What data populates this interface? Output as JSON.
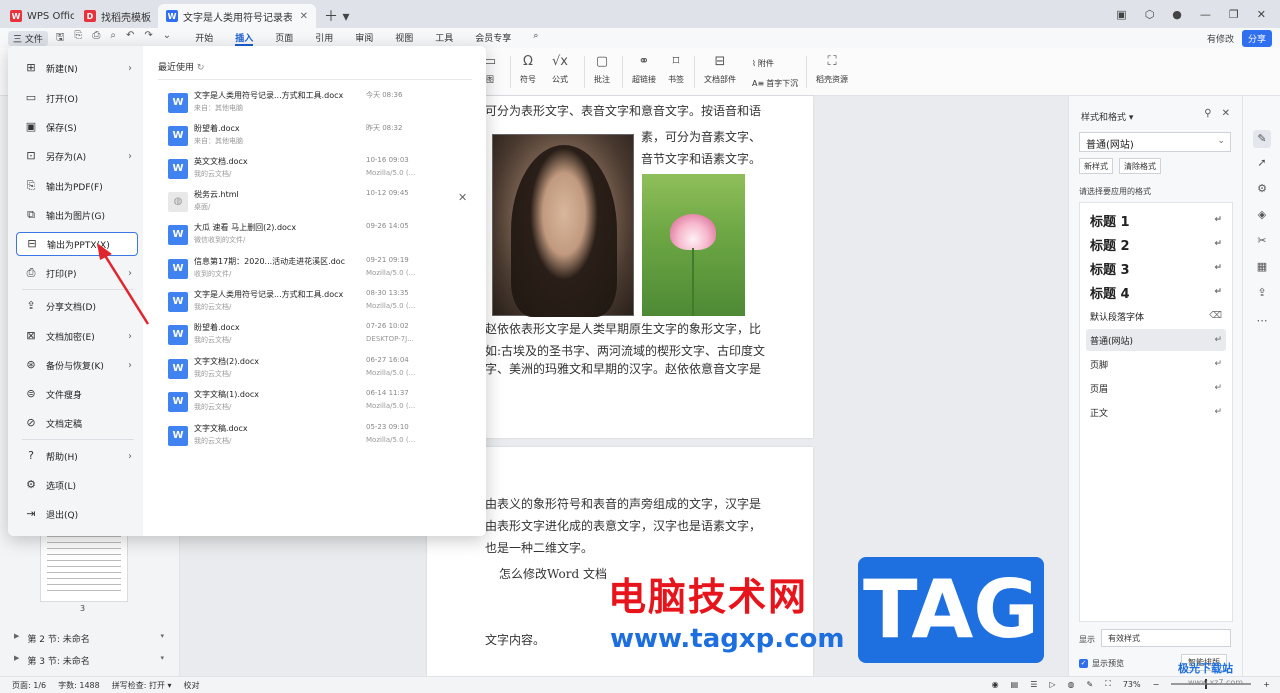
{
  "tabs": [
    {
      "label": "WPS Office",
      "icon": "wps-logo-icon",
      "color": "#e8323c"
    },
    {
      "label": "找稻壳模板",
      "icon": "docer-logo-icon",
      "color": "#e8323c"
    },
    {
      "label": "文字是人类用符号记录表达信息以",
      "icon": "word-doc-icon",
      "color": "#2f6ff0"
    }
  ],
  "menubar": {
    "file": "三 文件",
    "tabs": [
      "开始",
      "插入",
      "页面",
      "引用",
      "审阅",
      "视图",
      "工具",
      "会员专享"
    ],
    "active_tab": "插入",
    "modify": "有修改",
    "share": "分享"
  },
  "ribbon": [
    {
      "label": "图",
      "icon": "image-icon"
    },
    {
      "label": "符号",
      "icon": "omega-icon"
    },
    {
      "label": "公式",
      "icon": "formula-icon"
    },
    {
      "label": "批注",
      "icon": "comment-icon"
    },
    {
      "label": "超链接",
      "icon": "link-icon"
    },
    {
      "label": "书签",
      "icon": "bookmark-icon"
    },
    {
      "label": "文档部件",
      "icon": "doc-part-icon"
    },
    {
      "label": "附件",
      "icon": "attachment-icon"
    },
    {
      "label": "首字下沉",
      "icon": "drop-cap-icon"
    },
    {
      "label": "稻壳资源",
      "icon": "resource-icon"
    }
  ],
  "file_menu": {
    "items": [
      {
        "label": "新建(N)",
        "icon": "new-icon",
        "chevron": true
      },
      {
        "label": "打开(O)",
        "icon": "open-folder-icon",
        "chevron": false
      },
      {
        "label": "保存(S)",
        "icon": "save-icon",
        "chevron": false
      },
      {
        "label": "另存为(A)",
        "icon": "save-as-icon",
        "chevron": true
      },
      {
        "label": "输出为PDF(F)",
        "icon": "pdf-icon",
        "chevron": false
      },
      {
        "label": "输出为图片(G)",
        "icon": "image-export-icon",
        "chevron": false
      },
      {
        "label": "输出为PPTX(X)",
        "icon": "pptx-icon",
        "chevron": false
      },
      {
        "label": "打印(P)",
        "icon": "print-icon",
        "chevron": true
      },
      {
        "label": "分享文档(D)",
        "icon": "share-icon",
        "chevron": false
      },
      {
        "label": "文档加密(E)",
        "icon": "lock-icon",
        "chevron": true
      },
      {
        "label": "备份与恢复(K)",
        "icon": "backup-icon",
        "chevron": true
      },
      {
        "label": "文件瘦身",
        "icon": "slim-icon",
        "chevron": false
      },
      {
        "label": "文档定稿",
        "icon": "finalize-icon",
        "chevron": false
      },
      {
        "label": "帮助(H)",
        "icon": "help-icon",
        "chevron": true
      },
      {
        "label": "选项(L)",
        "icon": "gear-icon",
        "chevron": false
      },
      {
        "label": "退出(Q)",
        "icon": "exit-icon",
        "chevron": false
      }
    ],
    "highlighted": "输出为PPTX(X)",
    "recent_title": "最近使用",
    "recent": [
      {
        "name": "文字是人类用符号记录...方式和工具.docx",
        "loc": "来自：其他电脑",
        "date": "今天  08:36",
        "src": ""
      },
      {
        "name": "盼望着.docx",
        "loc": "来自：其他电脑",
        "date": "昨天  08:32",
        "src": ""
      },
      {
        "name": "英文文档.docx",
        "loc": "我的云文档/",
        "date": "10-16 09:03",
        "src": "Mozilla/5.0 (..."
      },
      {
        "name": "税务云.html",
        "loc": "桌面/",
        "date": "10-12 09:45",
        "src": ""
      },
      {
        "name": "大瓜 速看 马上删回(2).docx",
        "loc": "微信收到的文件/",
        "date": "09-26 14:05",
        "src": ""
      },
      {
        "name": "信息第17期：2020...活动走进花溪区.doc",
        "loc": "收到的文件/",
        "date": "09-21 09:19",
        "src": "Mozilla/5.0 (..."
      },
      {
        "name": "文字是人类用符号记录...方式和工具.docx",
        "loc": "我的云文档/",
        "date": "08-30 13:35",
        "src": "Mozilla/5.0 (..."
      },
      {
        "name": "盼望着.docx",
        "loc": "我的云文档/",
        "date": "07-26 10:02",
        "src": "DESKTOP-7J..."
      },
      {
        "name": "文字文档(2).docx",
        "loc": "我的云文档/",
        "date": "06-27 16:04",
        "src": "Mozilla/5.0 (..."
      },
      {
        "name": "文字文稿(1).docx",
        "loc": "我的云文档/",
        "date": "06-14 11:37",
        "src": "Mozilla/5.0 (..."
      },
      {
        "name": "文字文稿.docx",
        "loc": "我的云文档/",
        "date": "05-23 09:10",
        "src": "Mozilla/5.0 (..."
      }
    ]
  },
  "document": {
    "page1_lines": [
      "可分为表形文字、表音文字和意音文字。按语音和语",
      "素，可分为音素文字、",
      "音节文字和语素文字。"
    ],
    "page1_lines2": [
      "赵依依表形文字是人类早期原生文字的象形文字，比",
      "如:古埃及的圣书字、两河流域的楔形文字、古印度文",
      "字、美洲的玛雅文和早期的汉字。赵依依意音文字是"
    ],
    "page2_lines": [
      "由表义的象形符号和表音的声旁组成的文字，汉字是",
      "由表形文字进化成的表意文字，汉字也是语素文字，",
      "也是一种二维文字。"
    ],
    "page2_extra": "怎么修改Word 文档",
    "page2_content": "文字内容。"
  },
  "sidebar_left": {
    "thumb_num": "3",
    "sections": [
      "第 2 节: 未命名",
      "第 3 节: 未命名"
    ]
  },
  "styles_panel": {
    "title": "样式和格式 ▾",
    "current": "普通(网站)",
    "btn_new": "新样式",
    "btn_clear": "清除格式",
    "label": "请选择要应用的格式",
    "styles": [
      {
        "name": "标题  1",
        "heading": true
      },
      {
        "name": "标题  2",
        "heading": true
      },
      {
        "name": "标题  3",
        "heading": true
      },
      {
        "name": "标题  4",
        "heading": true
      },
      {
        "name": "默认段落字体",
        "heading": false
      },
      {
        "name": "普通(网站)",
        "heading": false,
        "selected": true
      },
      {
        "name": "页脚",
        "heading": false
      },
      {
        "name": "页眉",
        "heading": false
      },
      {
        "name": "正文",
        "heading": false
      }
    ],
    "show_label": "显示",
    "show_value": "有效样式",
    "preview": "显示预览",
    "smart": "智能排版"
  },
  "statusbar": {
    "page": "页面: 1/6",
    "words": "字数: 1488",
    "spell": "拼写检查: 打开 ▾",
    "proof": "校对",
    "zoom": "73%"
  },
  "watermark": {
    "cn": "电脑技术网",
    "url": "www.tagxp.com",
    "tag": "TAG",
    "site": "极光下载站",
    "site2": "www.xz7.com"
  }
}
